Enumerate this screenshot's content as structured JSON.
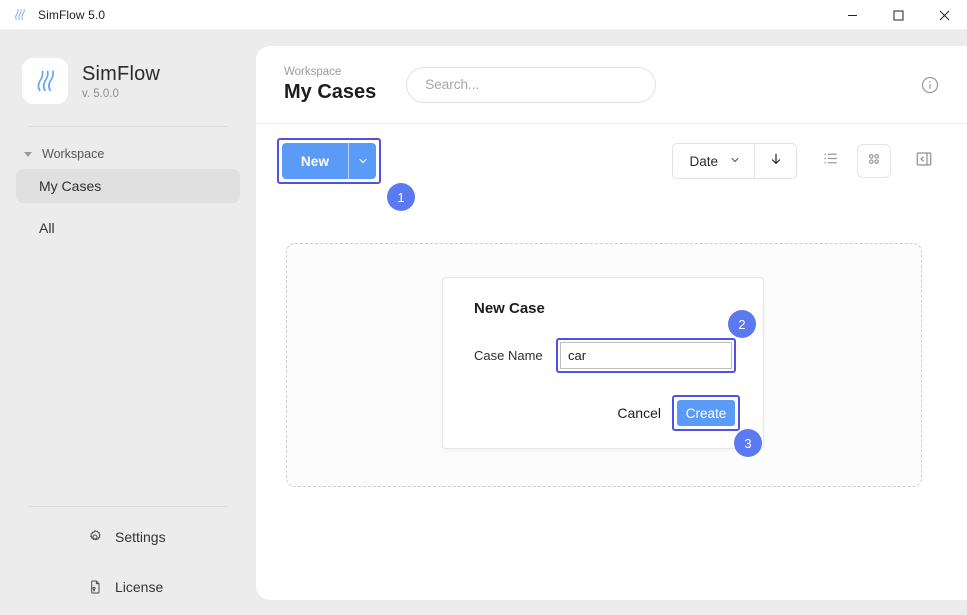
{
  "window": {
    "title": "SimFlow 5.0",
    "icon": "simflow-logo-icon",
    "minimize_label": "—",
    "maximize_label": "☐",
    "close_label": "✕"
  },
  "sidebar": {
    "brand_name": "SimFlow",
    "brand_version": "v. 5.0.0",
    "group_label": "Workspace",
    "items": [
      {
        "label": "My Cases",
        "active": true
      },
      {
        "label": "All",
        "active": false
      }
    ],
    "bottom_actions": [
      {
        "label": "Settings",
        "icon": "gear-icon"
      },
      {
        "label": "License",
        "icon": "license-document-icon"
      }
    ]
  },
  "header": {
    "breadcrumb": "Workspace",
    "title": "My Cases",
    "search_placeholder": "Search...",
    "search_value": "",
    "info_icon": "info-circle-icon"
  },
  "toolbar": {
    "new_label": "New",
    "new_caret_icon": "chevron-down-icon",
    "sort_label": "Date",
    "sort_caret_icon": "chevron-down-icon",
    "sort_direction_icon": "arrow-down-icon",
    "list_view_icon": "list-view-icon",
    "grid_view_icon": "grid-view-icon",
    "panel_toggle_icon": "collapse-panel-icon"
  },
  "dialog": {
    "title": "New Case",
    "field_label": "Case Name",
    "field_value": "car",
    "field_placeholder": "",
    "cancel_label": "Cancel",
    "create_label": "Create"
  },
  "annotations": {
    "badges": [
      {
        "number": "1",
        "target": "new-button"
      },
      {
        "number": "2",
        "target": "case-name-input"
      },
      {
        "number": "3",
        "target": "create-button"
      }
    ]
  },
  "colors": {
    "accent_blue": "#5b9bf8",
    "badge_blue": "#5b79f0",
    "highlight_border": "#5251e6",
    "app_background": "#ececec",
    "panel_background": "#ffffff"
  }
}
